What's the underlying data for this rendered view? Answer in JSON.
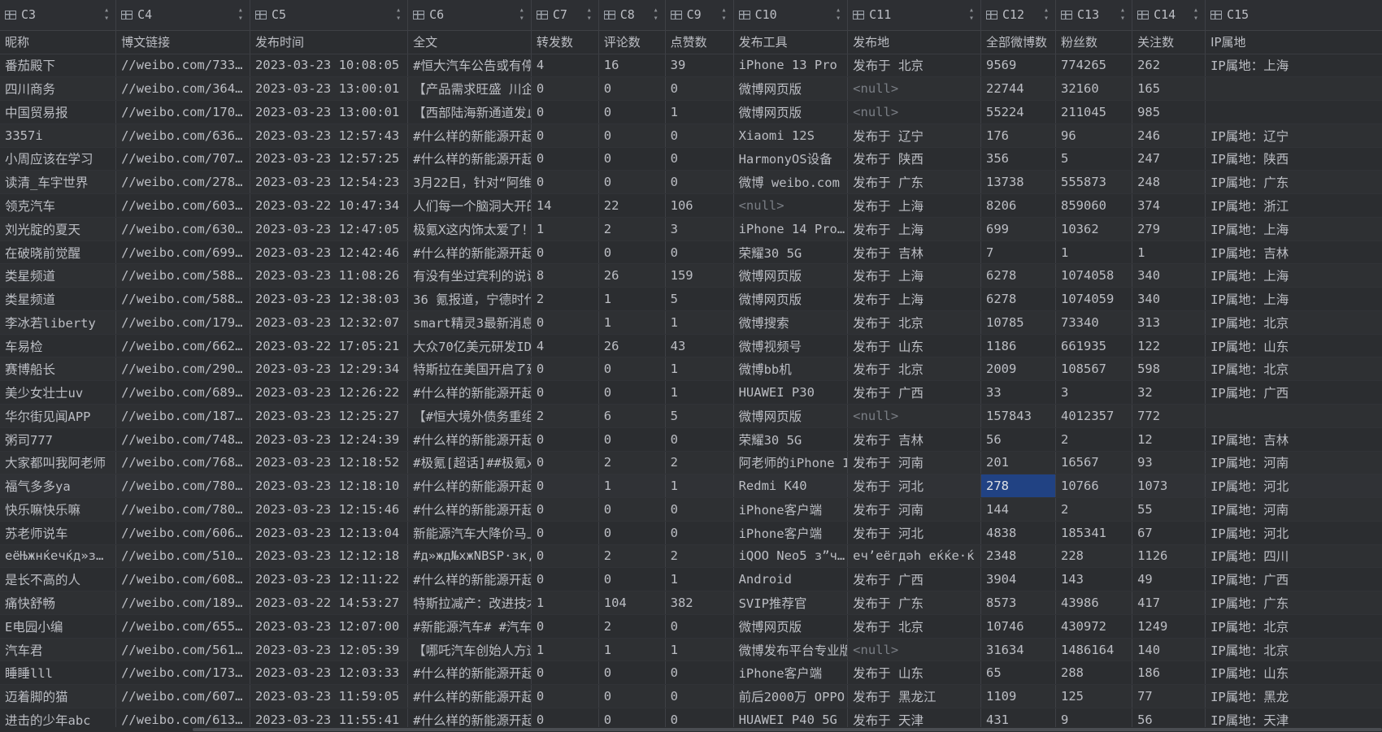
{
  "columns": [
    {
      "id": "C3",
      "name": "昵称"
    },
    {
      "id": "C4",
      "name": "博文链接"
    },
    {
      "id": "C5",
      "name": "发布时间"
    },
    {
      "id": "C6",
      "name": "全文"
    },
    {
      "id": "C7",
      "name": "转发数"
    },
    {
      "id": "C8",
      "name": "评论数"
    },
    {
      "id": "C9",
      "name": "点赞数"
    },
    {
      "id": "C10",
      "name": "发布工具"
    },
    {
      "id": "C11",
      "name": "发布地"
    },
    {
      "id": "C12",
      "name": "全部微博数"
    },
    {
      "id": "C13",
      "name": "粉丝数"
    },
    {
      "id": "C14",
      "name": "关注数"
    },
    {
      "id": "C15",
      "name": "IP属地"
    }
  ],
  "rows": [
    [
      "番茄殿下",
      "//weibo.com/733…",
      "2023-03-23 10:08:05",
      "#恒大汽车公告或有停…",
      "4",
      "16",
      "39",
      "iPhone 13 Pro",
      "发布于 北京",
      "9569",
      "774265",
      "262",
      "IP属地：上海"
    ],
    [
      "四川商务",
      "//weibo.com/364…",
      "2023-03-23 13:00:01",
      "【产品需求旺盛 川企…",
      "0",
      "0",
      "0",
      "微博网页版",
      "<null>",
      "22744",
      "32160",
      "165",
      ""
    ],
    [
      "中国贸易报",
      "//weibo.com/170…",
      "2023-03-23 13:00:01",
      "【西部陆海新通道发止…",
      "0",
      "0",
      "1",
      "微博网页版",
      "<null>",
      "55224",
      "211045",
      "985",
      ""
    ],
    [
      "3357i",
      "//weibo.com/636…",
      "2023-03-23 12:57:43",
      "#什么样的新能源开起…",
      "0",
      "0",
      "0",
      "Xiaomi 12S",
      "发布于 辽宁",
      "176",
      "96",
      "246",
      "IP属地：辽宁"
    ],
    [
      "小周应该在学习",
      "//weibo.com/707…",
      "2023-03-23 12:57:25",
      "#什么样的新能源开起…",
      "0",
      "0",
      "0",
      "HarmonyOS设备",
      "发布于 陕西",
      "356",
      "5",
      "247",
      "IP属地：陕西"
    ],
    [
      "读清_车宇世界",
      "//weibo.com/278…",
      "2023-03-23 12:54:23",
      "3月22日，针对“阿维…",
      "0",
      "0",
      "0",
      "微博 weibo.com",
      "发布于 广东",
      "13738",
      "555873",
      "248",
      "IP属地：广东"
    ],
    [
      "领克汽车",
      "//weibo.com/603…",
      "2023-03-22 10:47:34",
      "人们每一个脑洞大开的…",
      "14",
      "22",
      "106",
      "<null>",
      "发布于 上海",
      "8206",
      "859060",
      "374",
      "IP属地：浙江"
    ],
    [
      "刘光腚的夏天",
      "//weibo.com/630…",
      "2023-03-23 12:47:05",
      "极氪X这内饰太爱了！…",
      "1",
      "2",
      "3",
      "iPhone 14 Pro…",
      "发布于 上海",
      "699",
      "10362",
      "279",
      "IP属地：上海"
    ],
    [
      "在破晓前觉醒",
      "//weibo.com/699…",
      "2023-03-23 12:42:46",
      "#什么样的新能源开起…",
      "0",
      "0",
      "0",
      "荣耀30 5G",
      "发布于 吉林",
      "7",
      "1",
      "1",
      "IP属地：吉林"
    ],
    [
      "类星频道",
      "//weibo.com/588…",
      "2023-03-23 11:08:26",
      "有没有坐过宾利的说说…",
      "8",
      "26",
      "159",
      "微博网页版",
      "发布于 上海",
      "6278",
      "1074058",
      "340",
      "IP属地：上海"
    ],
    [
      "类星频道",
      "//weibo.com/588…",
      "2023-03-23 12:38:03",
      "36 氪报道，宁德时代…",
      "2",
      "1",
      "5",
      "微博网页版",
      "发布于 上海",
      "6278",
      "1074059",
      "340",
      "IP属地：上海"
    ],
    [
      "李冰若liberty",
      "//weibo.com/179…",
      "2023-03-23 12:32:07",
      "smart精灵3最新消息…",
      "0",
      "1",
      "1",
      "微博搜索",
      "发布于 北京",
      "10785",
      "73340",
      "313",
      "IP属地：北京"
    ],
    [
      "车易检",
      "//weibo.com/662…",
      "2023-03-22 17:05:21",
      "大众70亿美元研发ID…",
      "4",
      "26",
      "43",
      "微博视频号",
      "发布于 山东",
      "1186",
      "661935",
      "122",
      "IP属地：山东"
    ],
    [
      "赛博船长",
      "//weibo.com/290…",
      "2023-03-23 12:29:34",
      "特斯拉在美国开启了延…",
      "0",
      "0",
      "1",
      "微博bb机",
      "发布于 北京",
      "2009",
      "108567",
      "598",
      "IP属地：北京"
    ],
    [
      "美少女壮士uv",
      "//weibo.com/689…",
      "2023-03-23 12:26:22",
      "#什么样的新能源开起…",
      "0",
      "0",
      "1",
      "HUAWEI P30",
      "发布于 广西",
      "33",
      "3",
      "32",
      "IP属地：广西"
    ],
    [
      "华尔街见闻APP",
      "//weibo.com/187…",
      "2023-03-23 12:25:27",
      "【#恒大境外债务重组…",
      "2",
      "6",
      "5",
      "微博网页版",
      "<null>",
      "157843",
      "4012357",
      "772",
      ""
    ],
    [
      "粥司777",
      "//weibo.com/748…",
      "2023-03-23 12:24:39",
      "#什么样的新能源开起…",
      "0",
      "0",
      "0",
      "荣耀30 5G",
      "发布于 吉林",
      "56",
      "2",
      "12",
      "IP属地：吉林"
    ],
    [
      "大家都叫我阿老师",
      "//weibo.com/768…",
      "2023-03-23 12:18:52",
      "#极氪[超话]##极氪x…",
      "0",
      "2",
      "2",
      "阿老师的iPhone 1…",
      "发布于 河南",
      "201",
      "16567",
      "93",
      "IP属地：河南"
    ],
    [
      "福气多多ya",
      "//weibo.com/780…",
      "2023-03-23 12:18:10",
      "#什么样的新能源开起…",
      "0",
      "1",
      "1",
      "Redmi K40",
      "发布于 河北",
      "278",
      "10766",
      "1073",
      "IP属地：河北"
    ],
    [
      "快乐嘛快乐嘛",
      "//weibo.com/780…",
      "2023-03-23 12:15:46",
      "#什么样的新能源开起…",
      "0",
      "0",
      "0",
      "iPhone客户端",
      "发布于 河南",
      "144",
      "2",
      "55",
      "IP属地：河南"
    ],
    [
      "苏老师说车",
      "//weibo.com/606…",
      "2023-03-23 12:13:04",
      "新能源汽车大降价马上…",
      "0",
      "0",
      "0",
      "iPhone客户端",
      "发布于 河北",
      "4838",
      "185341",
      "67",
      "IP属地：河北"
    ],
    [
      "eёЊжнќечќд»з…",
      "//weibo.com/510…",
      "2023-03-23 12:12:18",
      "#д»жд№хжNBSP·зк,…",
      "0",
      "2",
      "2",
      "iQOO Neo5 з”ч…",
      "еч’еёгдәһ еќќе·ќ",
      "2348",
      "228",
      "1126",
      "IP属地：四川"
    ],
    [
      "是长不高的人",
      "//weibo.com/608…",
      "2023-03-23 12:11:22",
      "#什么样的新能源开起…",
      "0",
      "0",
      "1",
      "Android",
      "发布于 广西",
      "3904",
      "143",
      "49",
      "IP属地：广西"
    ],
    [
      "痛快舒畅",
      "//weibo.com/189…",
      "2023-03-22 14:53:27",
      "特斯拉减产：改进技术…",
      "1",
      "104",
      "382",
      "SVIP推荐官",
      "发布于 广东",
      "8573",
      "43986",
      "417",
      "IP属地：广东"
    ],
    [
      "E电园小编",
      "//weibo.com/655…",
      "2023-03-23 12:07:00",
      "#新能源汽车# #汽车…",
      "0",
      "2",
      "0",
      "微博网页版",
      "发布于 北京",
      "10746",
      "430972",
      "1249",
      "IP属地：北京"
    ],
    [
      "汽车君",
      "//weibo.com/561…",
      "2023-03-23 12:05:39",
      "【哪吒汽车创始人方运…",
      "1",
      "1",
      "1",
      "微博发布平台专业版",
      "<null>",
      "31634",
      "1486164",
      "140",
      "IP属地：北京"
    ],
    [
      "睡睡lll",
      "//weibo.com/173…",
      "2023-03-23 12:03:33",
      "#什么样的新能源开起…",
      "0",
      "0",
      "0",
      "iPhone客户端",
      "发布于 山东",
      "65",
      "288",
      "186",
      "IP属地：山东"
    ],
    [
      "迈着脚的猫",
      "//weibo.com/607…",
      "2023-03-23 11:59:05",
      "#什么样的新能源开起…",
      "0",
      "0",
      "0",
      "前后2000万 OPPO",
      "发布于 黑龙江",
      "1109",
      "125",
      "77",
      "IP属地：黑龙"
    ],
    [
      "进击的少年abc",
      "//weibo.com/613…",
      "2023-03-23 11:55:41",
      "#什么样的新能源开起…",
      "0",
      "0",
      "0",
      "HUAWEI P40 5G",
      "发布于 天津",
      "431",
      "9",
      "56",
      "IP属地：天津"
    ]
  ],
  "selected": {
    "row": 18,
    "col": 9
  },
  "null_text": "<null>",
  "colors": {
    "selection": "#214283",
    "background": "#2b2d30",
    "text": "#bcbec4",
    "null": "#7a7e85"
  }
}
